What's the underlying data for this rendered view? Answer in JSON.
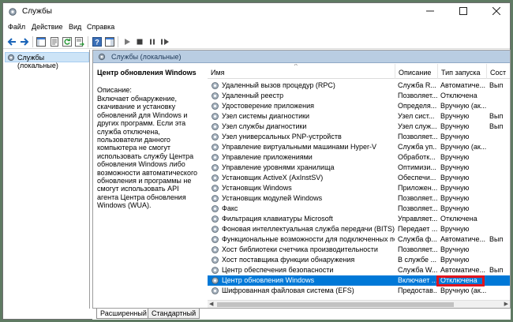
{
  "window": {
    "title": "Службы"
  },
  "menu": [
    "Файл",
    "Действие",
    "Вид",
    "Справка"
  ],
  "toolbar": [
    "back-icon",
    "forward-icon",
    "console-tree-icon",
    "properties-icon",
    "refresh-icon",
    "export-list-icon",
    "help-icon",
    "show-pane-icon",
    "start-icon",
    "stop-icon",
    "pause-icon",
    "restart-icon"
  ],
  "tree": {
    "root_label": "Службы (локальные)"
  },
  "header": {
    "title": "Службы (локальные)"
  },
  "description": {
    "service_name": "Центр обновления Windows",
    "label": "Описание:",
    "text": "Включает обнаружение, скачивание и установку обновлений для Windows и других программ. Если эта служба отключена, пользователи данного компьютера не смогут использовать службу Центра обновления Windows либо возможности автоматического обновления и программы не смогут использовать API агента Центра обновления Windows (WUA)."
  },
  "columns": [
    "Имя",
    "Описание",
    "Тип запуска",
    "Сост"
  ],
  "rows": [
    {
      "name": "Удаленный вызов процедур (RPC)",
      "desc": "Служба R...",
      "type": "Автоматиче...",
      "status": "Вып"
    },
    {
      "name": "Удаленный реестр",
      "desc": "Позволяет...",
      "type": "Отключена",
      "status": ""
    },
    {
      "name": "Удостоверение приложения",
      "desc": "Определя...",
      "type": "Вручную (ак...",
      "status": ""
    },
    {
      "name": "Узел системы диагностики",
      "desc": "Узел сист...",
      "type": "Вручную",
      "status": "Вып"
    },
    {
      "name": "Узел службы диагностики",
      "desc": "Узел служ...",
      "type": "Вручную",
      "status": "Вып"
    },
    {
      "name": "Узел универсальных PNP-устройств",
      "desc": "Позволяет...",
      "type": "Вручную",
      "status": ""
    },
    {
      "name": "Управление виртуальными машинами Hyper-V",
      "desc": "Служба уп...",
      "type": "Вручную (ак...",
      "status": ""
    },
    {
      "name": "Управление приложениями",
      "desc": "Обработк...",
      "type": "Вручную",
      "status": ""
    },
    {
      "name": "Управление уровнями хранилища",
      "desc": "Оптимизи...",
      "type": "Вручную",
      "status": ""
    },
    {
      "name": "Установщик ActiveX (AxInstSV)",
      "desc": "Обеспечи...",
      "type": "Вручную",
      "status": ""
    },
    {
      "name": "Установщик Windows",
      "desc": "Приложен...",
      "type": "Вручную",
      "status": ""
    },
    {
      "name": "Установщик модулей Windows",
      "desc": "Позволяет...",
      "type": "Вручную",
      "status": ""
    },
    {
      "name": "Факс",
      "desc": "Позволяет...",
      "type": "Вручную",
      "status": ""
    },
    {
      "name": "Фильтрация клавиатуры Microsoft",
      "desc": "Управляет...",
      "type": "Отключена",
      "status": ""
    },
    {
      "name": "Фоновая интеллектуальная служба передачи (BITS)",
      "desc": "Передает ...",
      "type": "Вручную",
      "status": ""
    },
    {
      "name": "Функциональные возможности для подключенных пользователей ...",
      "desc": "Служба ф...",
      "type": "Автоматиче...",
      "status": "Вып"
    },
    {
      "name": "Хост библиотеки счетчика производительности",
      "desc": "Позволяет...",
      "type": "Вручную",
      "status": ""
    },
    {
      "name": "Хост поставщика функции обнаружения",
      "desc": "В службе ...",
      "type": "Вручную",
      "status": ""
    },
    {
      "name": "Центр обеспечения безопасности",
      "desc": "Служба W...",
      "type": "Автоматиче...",
      "status": "Вып"
    },
    {
      "name": "Центр обновления Windows",
      "desc": "Включает ...",
      "type": "Отключена",
      "status": ""
    },
    {
      "name": "Шифрованная файловая система (EFS)",
      "desc": "Предостав...",
      "type": "Вручную (ак...",
      "status": ""
    }
  ],
  "selected_row": 19,
  "tabs": [
    "Расширенный",
    "Стандартный"
  ],
  "colors": {
    "selection": "#0078d7",
    "highlight_box": "#e0141e",
    "header_bar": "#b9cde2"
  }
}
